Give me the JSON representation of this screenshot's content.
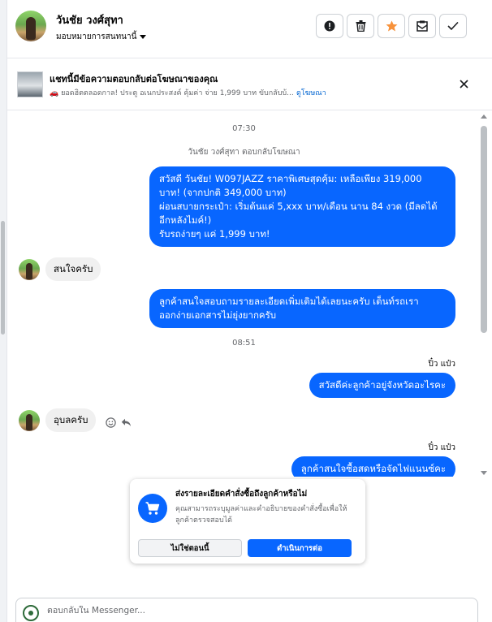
{
  "header": {
    "name": "วันชัย วงศ์สุทา",
    "assign_label": "มอบหมายการสนทนานี้",
    "actions": [
      {
        "icon": "alert-icon"
      },
      {
        "icon": "trash-icon"
      },
      {
        "icon": "star-icon",
        "color": "#f7923b"
      },
      {
        "icon": "mark-unread-icon"
      },
      {
        "icon": "check-icon"
      }
    ]
  },
  "ad_banner": {
    "title": "แชทนี้มีข้อความตอบกลับต่อโฆษณาของคุณ",
    "subtitle": "🚗 ยอดฮิตตลอดกาล! ประตู อเนกประสงค์ คุ้มค่า จ่าย 1,999 บาท ขับกลับบ้...",
    "link": "ดูโฆษณา"
  },
  "chat": {
    "time_1": "07:30",
    "replied_note": "วันชัย วงศ์สุทา ตอบกลับโฆษณา",
    "out_1": [
      "สวัสดี วันชัย! W097JAZZ ราคาพิเศษสุดคุ้ม: เหลือเพียง 319,000",
      "บาท! (จากปกติ 349,000 บาท)",
      "ผ่อนสบายกระเป๋า: เริ่มต้นแค่ 5,xxx บาท/เดือน นาน 84 งวด (มีลดได้",
      "อีกหลังไมค์!)",
      "รับรถง่ายๆ แค่ 1,999 บาท!"
    ],
    "in_1": "สนใจครับ",
    "out_2": [
      "ลูกค้าสนใจสอบถามรายละเอียดเพิ่มเติมได้เลยนะครับ เต็นท์รถเรา",
      "ออกง่ายเอกสารไม่ยุ่งยากครับ"
    ],
    "time_2": "08:51",
    "sender_1": "ปิ๋ว แป๋ว",
    "out_3": "สวัสดีค่ะลูกค้าอยู่จังหวัดอะไรคะ",
    "in_2": "อุบลครับ",
    "sender_2": "ปิ๋ว แป๋ว",
    "out_4": "ลูกค้าสนใจซื้อสดหรือจัดไฟแนนซ์คะ"
  },
  "order_card": {
    "title": "ส่งรายละเอียดคำสั่งซื้อถึงลูกค้าหรือไม่",
    "description": "คุณสามารถระบุมูลค่าและคำอธิบายของคำสั่งซื้อเพื่อให้ลูกค้าตรวจสอบได้",
    "secondary_button": "ไม่ใช่ตอนนี้",
    "primary_button": "ดำเนินการต่อ"
  },
  "composer": {
    "placeholder": "ตอบกลับใน Messenger..."
  },
  "colors": {
    "accent": "#0866ff",
    "link": "#0064d1",
    "star": "#f7923b"
  }
}
